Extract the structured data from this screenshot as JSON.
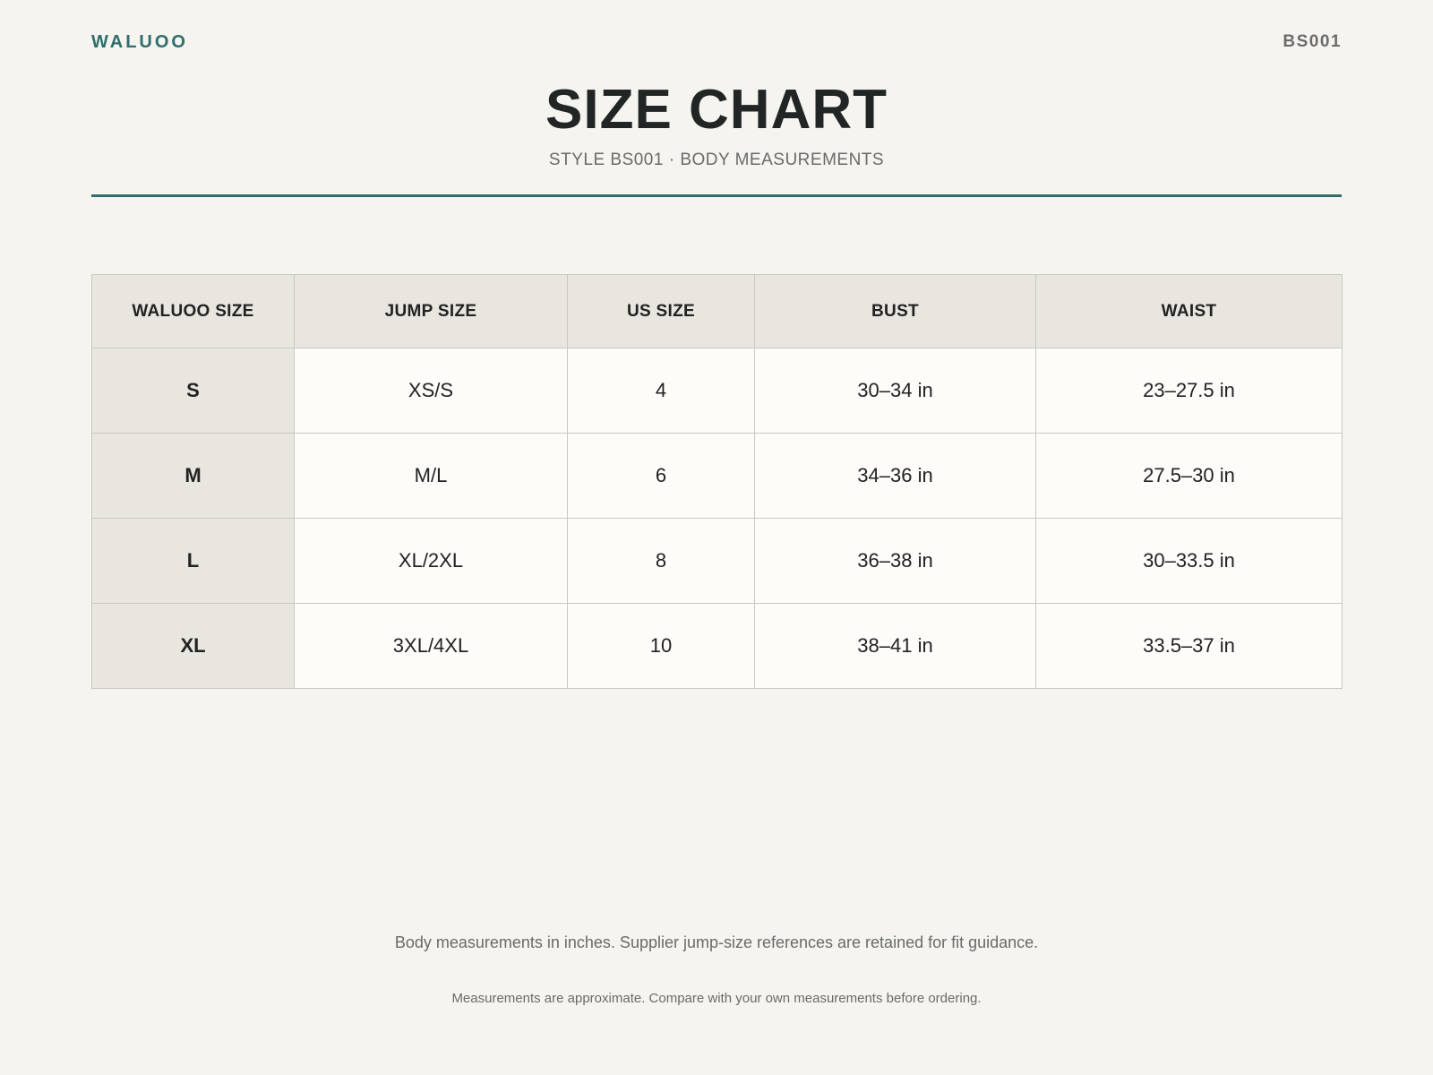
{
  "header": {
    "brand": "WALUOO",
    "code": "BS001",
    "title": "SIZE CHART",
    "subtitle": "STYLE BS001 · BODY MEASUREMENTS"
  },
  "colors": {
    "accent": "#2e6e6c",
    "background": "#f5f4ef",
    "header_cell": "#e9e6e0",
    "body_cell": "#fdfcf9",
    "border": "#c9c8c3"
  },
  "table": {
    "columns": [
      "WALUOO SIZE",
      "JUMP SIZE",
      "US SIZE",
      "BUST",
      "WAIST"
    ],
    "rows": [
      [
        "S",
        "XS/S",
        "4",
        "30–34 in",
        "23–27.5 in"
      ],
      [
        "M",
        "M/L",
        "6",
        "34–36 in",
        "27.5–30 in"
      ],
      [
        "L",
        "XL/2XL",
        "8",
        "36–38 in",
        "30–33.5 in"
      ],
      [
        "XL",
        "3XL/4XL",
        "10",
        "38–41 in",
        "33.5–37 in"
      ]
    ]
  },
  "footer": {
    "note": "Body measurements in inches. Supplier jump-size references are retained for fit guidance.",
    "disclaimer": "Measurements are approximate. Compare with your own measurements before ordering."
  }
}
